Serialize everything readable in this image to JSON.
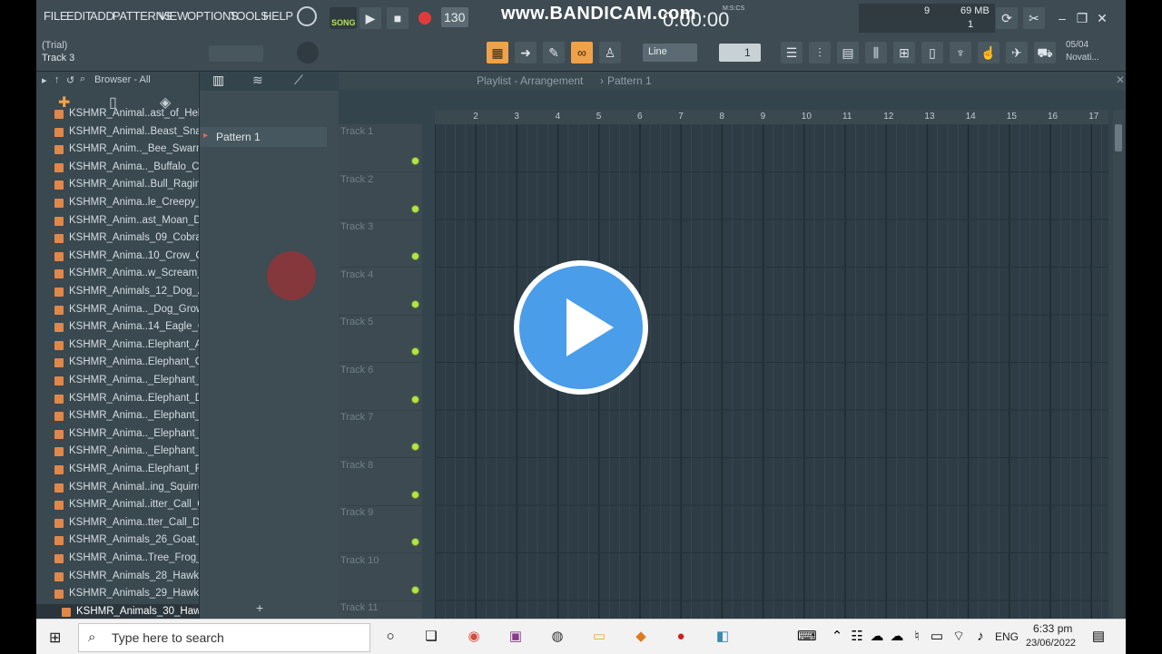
{
  "menu": [
    "FILE",
    "EDIT",
    "ADD",
    "PATTERNS",
    "VIEW",
    "OPTIONS",
    "TOOLS",
    "HELP"
  ],
  "transport": {
    "mode_label": "SONG",
    "tempo": "130",
    "time_display": "0:00:00",
    "time_unit": "M:S:CS"
  },
  "watermark": "www.BANDICAM.com",
  "status": {
    "trial_label": "(Trial)",
    "hint_label": "Track 3",
    "memory": "69 MB",
    "cpu": "9",
    "poly": "1"
  },
  "snap": {
    "mode": "Line",
    "step": "1"
  },
  "news": {
    "date": "05/04",
    "text": "Novati..."
  },
  "browser": {
    "title": "Browser - All",
    "items": [
      "KSHMR_Animal..ast_of_Hell",
      "KSHMR_Animal..Beast_Snarl",
      "KSHMR_Anim.._Bee_Swarm",
      "KSHMR_Anima.._Buffalo_C#",
      "KSHMR_Animal..Bull_Raging",
      "KSHMR_Anima..le_Creepy_A",
      "KSHMR_Anim..ast_Moan_D#",
      "KSHMR_Animals_09_Cobra",
      "KSHMR_Anima..10_Crow_C#",
      "KSHMR_Anima..w_Scream_E",
      "KSHMR_Animals_12_Dog_A",
      "KSHMR_Anima.._Dog_Growl",
      "KSHMR_Anima..14_Eagle_C#",
      "KSHMR_Anima..Elephant_A#",
      "KSHMR_Anima..Elephant_C#",
      "KSHMR_Anima.._Elephant_D",
      "KSHMR_Anima..Elephant_D#",
      "KSHMR_Anima.._Elephant_E",
      "KSHMR_Anima.._Elephant_F",
      "KSHMR_Anima.._Elephant_F",
      "KSHMR_Anima..Elephant_F#",
      "KSHMR_Animal..ing_Squirrel",
      "KSHMR_Animal..itter_Call_C",
      "KSHMR_Anima..tter_Call_D#",
      "KSHMR_Animals_26_Goat_D",
      "KSHMR_Anima..Tree_Frog_A",
      "KSHMR_Animals_28_Hawk",
      "KSHMR_Animals_29_Hawk",
      "KSHMR_Animals_30_Hawk"
    ]
  },
  "patterns": {
    "selected": "Pattern 1",
    "add_label": "+"
  },
  "playlist": {
    "title": "Playlist - Arrangement",
    "breadcrumb_sep": "›",
    "current_pattern": "Pattern 1",
    "ruler": [
      "2",
      "3",
      "4",
      "5",
      "6",
      "7",
      "8",
      "9",
      "10",
      "11",
      "12",
      "13",
      "14",
      "15",
      "16",
      "17"
    ],
    "tracks": [
      "Track 1",
      "Track 2",
      "Track 3",
      "Track 4",
      "Track 5",
      "Track 6",
      "Track 7",
      "Track 8",
      "Track 9",
      "Track 10",
      "Track 11"
    ]
  },
  "taskbar": {
    "search_placeholder": "Type here to search",
    "lang": "ENG",
    "time": "6:33 pm",
    "date": "23/06/2022"
  }
}
